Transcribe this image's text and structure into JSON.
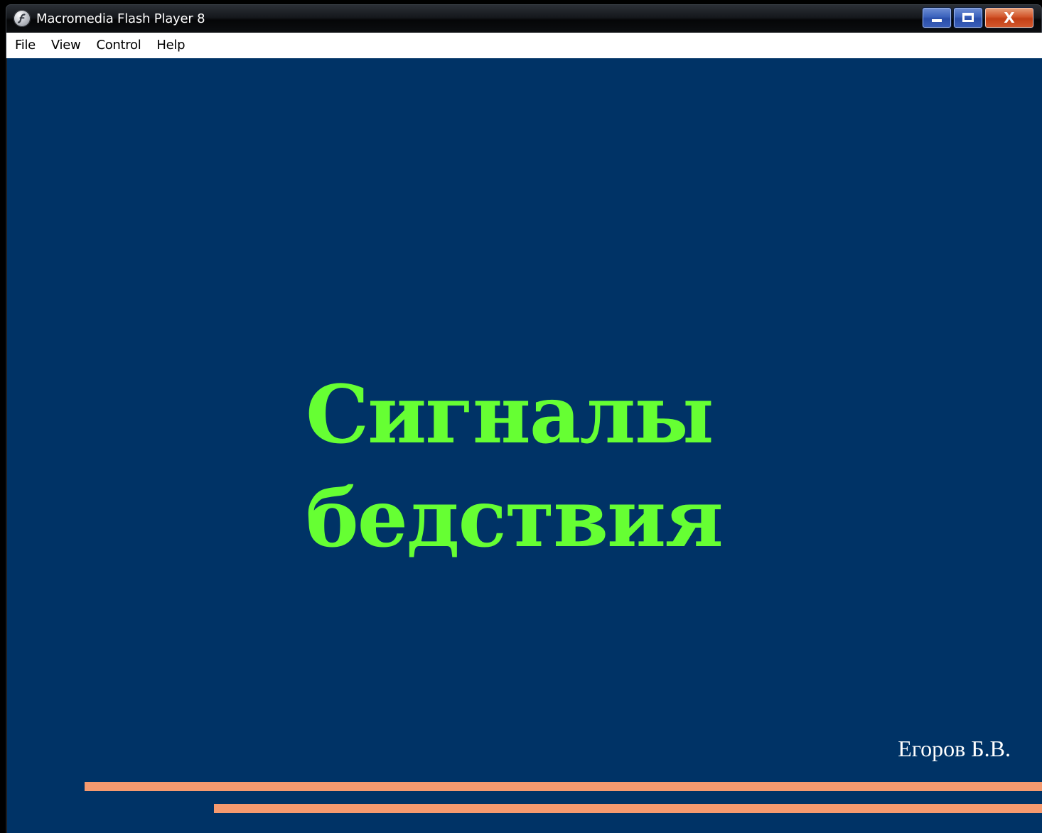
{
  "window": {
    "title": "Macromedia Flash Player 8",
    "icon": "flash-player-icon",
    "controls": {
      "minimize": "minimize-icon",
      "maximize": "maximize-icon",
      "close_label": "X"
    }
  },
  "menubar": {
    "items": [
      {
        "label": "File"
      },
      {
        "label": "View"
      },
      {
        "label": "Control"
      },
      {
        "label": "Help"
      }
    ]
  },
  "slide": {
    "title_line1": "Сигналы",
    "title_line2": "бедствия",
    "author": "Егоров Б.В.",
    "colors": {
      "background": "#003366",
      "title": "#66ff33",
      "author": "#ffffff",
      "stripes": "#f59a6f"
    }
  }
}
